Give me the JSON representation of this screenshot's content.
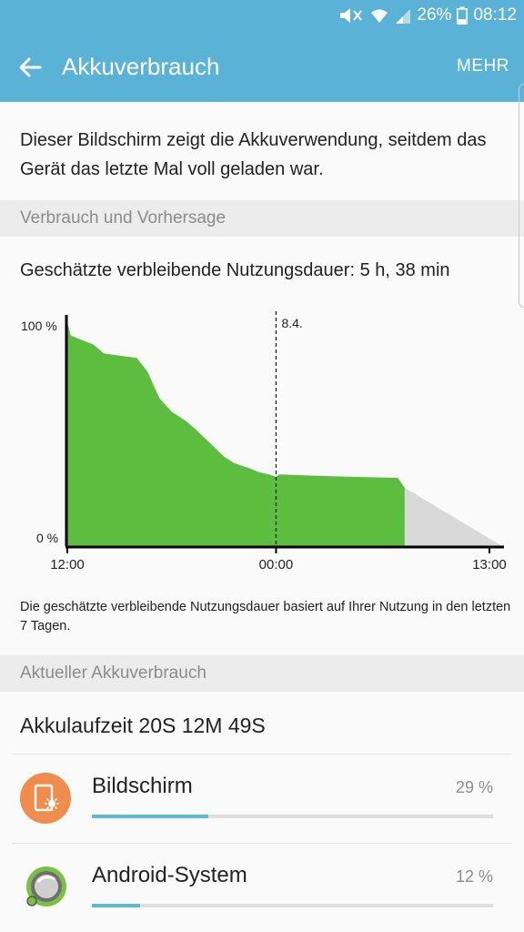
{
  "status": {
    "battery_pct": "26%",
    "time": "08:12"
  },
  "appbar": {
    "title": "Akkuverbrauch",
    "more": "MEHR"
  },
  "intro": {
    "text": "Dieser Bildschirm zeigt die Akkuverwendung, seitdem das Gerät das letzte Mal voll geladen war."
  },
  "section_forecast": {
    "header": "Verbrauch und Vorhersage"
  },
  "forecast": {
    "remaining": "Geschätzte verbleibende Nutzungsdauer: 5 h, 38 min",
    "note": "Die geschätzte verbleibende Nutzungsdauer basiert auf Ihrer Nutzung in den letzten 7 Tagen."
  },
  "chart_data": {
    "type": "area",
    "y_tick_labels": [
      "100 %",
      "0 %"
    ],
    "x_tick_labels": [
      "12:00",
      "00:00",
      "13:00"
    ],
    "marker_label": "8.4.",
    "ylim": [
      0,
      100
    ],
    "x_hours_range": [
      0,
      25
    ],
    "marker_hour": 12,
    "series": [
      {
        "values_hours": [
          0,
          0.2,
          1.5,
          2.1,
          4.0,
          4.6,
          5.3,
          6.0,
          6.8,
          7.4,
          8.2,
          9.0,
          9.6,
          10.4,
          11.0,
          11.6,
          12.0,
          12.2,
          14.0,
          16.0,
          19.0,
          19.4
        ],
        "values_pct": [
          100,
          94,
          90,
          86,
          84,
          78,
          66,
          60,
          56,
          52,
          46,
          40,
          37,
          35,
          33,
          32,
          31,
          32,
          31.5,
          31,
          30.5,
          26
        ],
        "style": "measured",
        "color": "#5dbd3e"
      },
      {
        "values_hours": [
          19.4,
          25
        ],
        "values_pct": [
          26,
          0
        ],
        "style": "predicted",
        "color": "#d9d9d9"
      }
    ],
    "colors": {
      "axis": "#000000",
      "measured": "#5dbd3e",
      "predicted": "#d9d9d9"
    }
  },
  "section_usage": {
    "header": "Aktueller Akkuverbrauch"
  },
  "usage": {
    "runtime": "Akkulaufzeit 20S 12M 49S",
    "apps": [
      {
        "name": "Bildschirm",
        "percent": "29 %",
        "share": 0.29,
        "icon": "screen-brightness-icon",
        "icon_color": "#f08c4c"
      },
      {
        "name": "Android-System",
        "percent": "12 %",
        "share": 0.12,
        "icon": "android-system-icon",
        "icon_color": "#7ac143"
      }
    ]
  },
  "colors": {
    "accent": "#5ab3d6",
    "bar": "#5bb9d8"
  }
}
